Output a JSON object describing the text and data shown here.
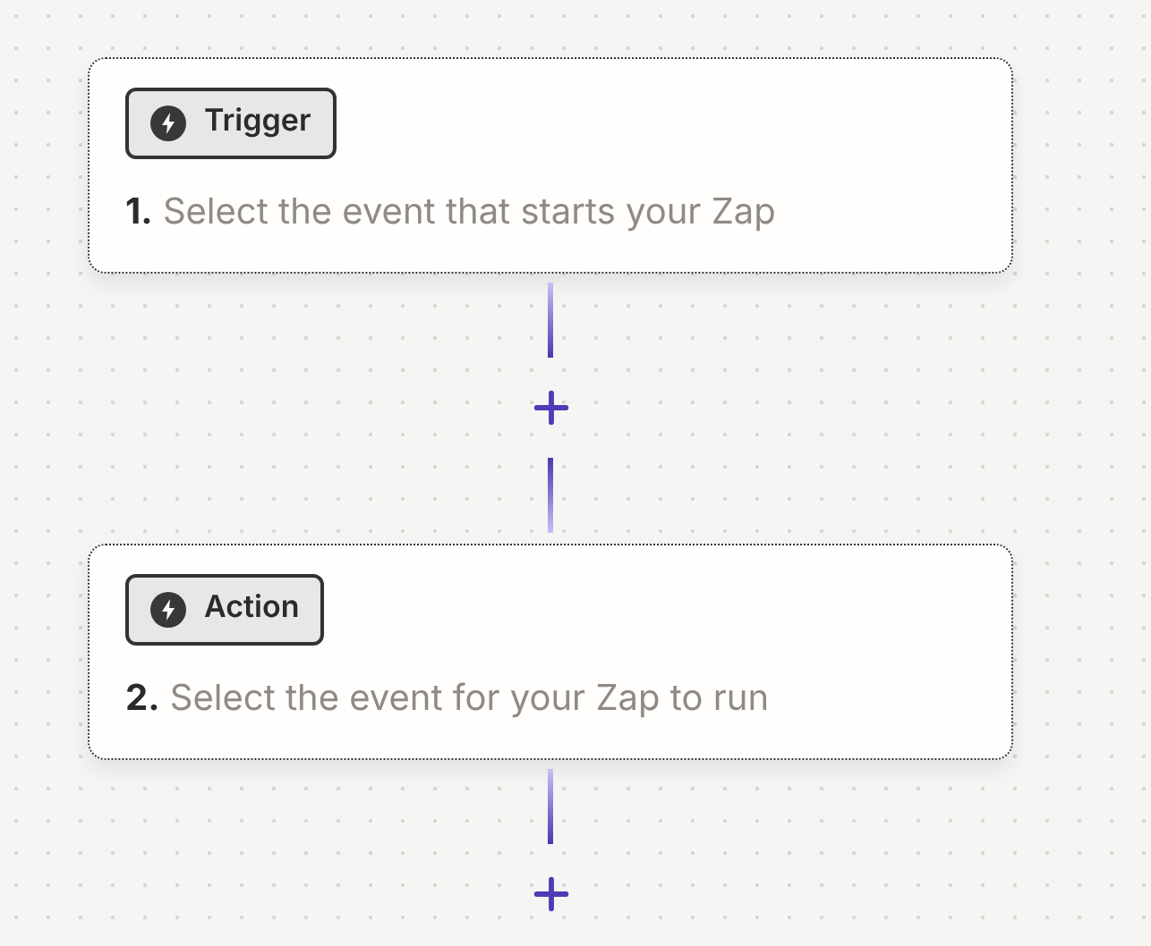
{
  "steps": [
    {
      "badge": "Trigger",
      "title": "**1.** Select the event that starts your Zap"
    },
    {
      "badge": "Action",
      "title": "**2.** Select the event for your Zap to run"
    }
  ]
}
